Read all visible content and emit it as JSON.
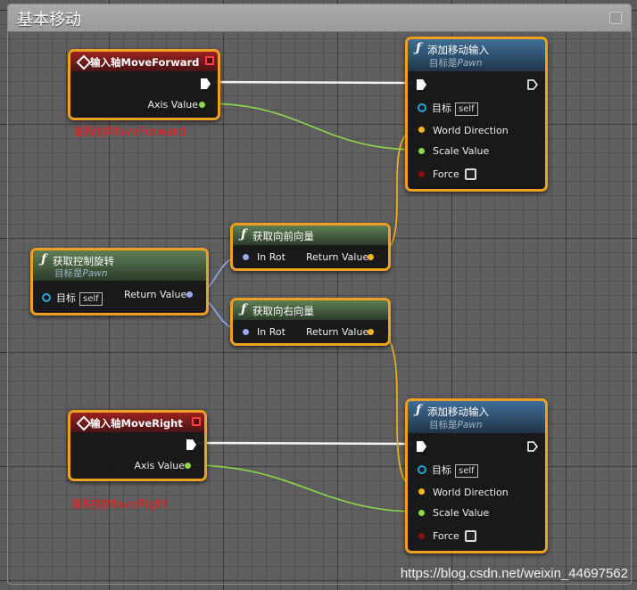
{
  "comment": {
    "title": "基本移动"
  },
  "nodes": {
    "input_forward": {
      "title": "输入轴MoveForward",
      "pin": "Axis Value",
      "note": "轴映射MoveForward"
    },
    "input_right": {
      "title": "输入轴MoveRight",
      "pin": "Axis Value",
      "note": "轴映射MoveRight"
    },
    "add_move_1": {
      "title": "添加移动输入",
      "subtitle_prefix": "目标是",
      "subtitle_target": "Pawn",
      "pins": {
        "target": "目标",
        "target_default": "self",
        "world_direction": "World Direction",
        "scale_value": "Scale Value",
        "force": "Force"
      }
    },
    "add_move_2": {
      "title": "添加移动输入",
      "subtitle_prefix": "目标是",
      "subtitle_target": "Pawn",
      "pins": {
        "target": "目标",
        "target_default": "self",
        "world_direction": "World Direction",
        "scale_value": "Scale Value",
        "force": "Force"
      }
    },
    "get_control_rotation": {
      "title": "获取控制旋转",
      "subtitle_prefix": "目标是",
      "subtitle_target": "Pawn",
      "pins": {
        "target": "目标",
        "target_default": "self",
        "return_value": "Return Value"
      }
    },
    "get_forward_vector": {
      "title": "获取向前向量",
      "pins": {
        "in_rot": "In Rot",
        "return_value": "Return Value"
      }
    },
    "get_right_vector": {
      "title": "获取向右向量",
      "pins": {
        "in_rot": "In Rot",
        "return_value": "Return Value"
      }
    }
  },
  "colors": {
    "node_border": "#f0a020",
    "float_pin": "#8cd94a",
    "vector_pin": "#f5b41e",
    "rotator_pin": "#99a6f0",
    "object_pin": "#22aadd",
    "bool_pin": "#8a1010",
    "note_text": "#e02020"
  },
  "watermark": "https://blog.csdn.net/weixin_44697562"
}
